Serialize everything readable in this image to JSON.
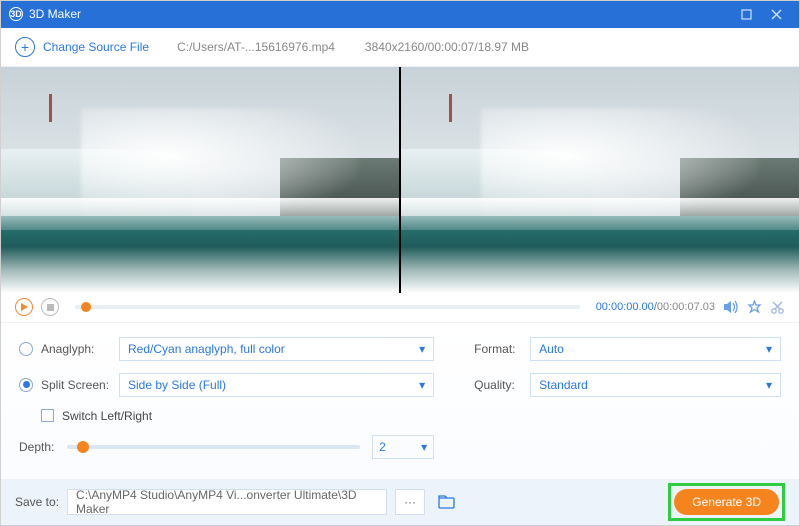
{
  "titlebar": {
    "app_name": "3D Maker"
  },
  "toolbar": {
    "change_source_label": "Change Source File",
    "file_path": "C:/Users/AT-...15616976.mp4",
    "file_meta": "3840x2160/00:00:07/18.97 MB"
  },
  "playbar": {
    "current_time": "00:00:00.00",
    "duration": "00:00:07.03"
  },
  "options": {
    "anaglyph": {
      "label": "Anaglyph:",
      "value": "Red/Cyan anaglyph, full color",
      "selected": false
    },
    "split_screen": {
      "label": "Split Screen:",
      "value": "Side by Side (Full)",
      "selected": true
    },
    "switch_lr_label": "Switch Left/Right",
    "depth": {
      "label": "Depth:",
      "value": "2"
    },
    "format": {
      "label": "Format:",
      "value": "Auto"
    },
    "quality": {
      "label": "Quality:",
      "value": "Standard"
    }
  },
  "bottombar": {
    "save_to_label": "Save to:",
    "save_path": "C:\\AnyMP4 Studio\\AnyMP4 Vi...onverter Ultimate\\3D Maker",
    "browse_dots": "···",
    "generate_label": "Generate 3D"
  }
}
